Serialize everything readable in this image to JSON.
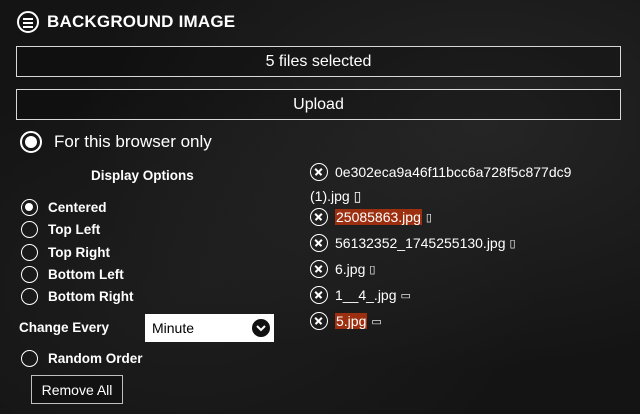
{
  "header": {
    "title": "BACKGROUND IMAGE",
    "menu_icon": "hamburger-circle-icon"
  },
  "files_button": {
    "label": "5 files selected"
  },
  "upload_button": {
    "label": "Upload"
  },
  "scope": {
    "label": "For this browser only",
    "selected": true
  },
  "display_options": {
    "title": "Display Options",
    "options": [
      {
        "label": "Centered",
        "selected": true
      },
      {
        "label": "Top Left",
        "selected": false
      },
      {
        "label": "Top Right",
        "selected": false
      },
      {
        "label": "Bottom Left",
        "selected": false
      },
      {
        "label": "Bottom Right",
        "selected": false
      }
    ]
  },
  "change_every": {
    "label": "Change Every",
    "value": "Minute"
  },
  "random_order": {
    "label": "Random Order",
    "selected": false
  },
  "remove_all": {
    "label": "Remove All"
  },
  "files": [
    {
      "name": "0e302eca9a46f11bcc6a728f5c877dc9",
      "highlighted": false,
      "glyph": ""
    },
    {
      "name": "25085863.jpg",
      "highlighted": true,
      "glyph": "▯"
    },
    {
      "name": "56132352_1745255130.jpg",
      "highlighted": false,
      "glyph": "▯"
    },
    {
      "name": "6.jpg",
      "highlighted": false,
      "glyph": "▯"
    },
    {
      "name": "1__4_.jpg",
      "highlighted": false,
      "glyph": "▭"
    },
    {
      "name": "5.jpg",
      "highlighted": true,
      "glyph": "▭"
    }
  ],
  "file_continuation": "(1).jpg ▯",
  "colors": {
    "highlight": "#9b2f10",
    "background": "#141414"
  }
}
